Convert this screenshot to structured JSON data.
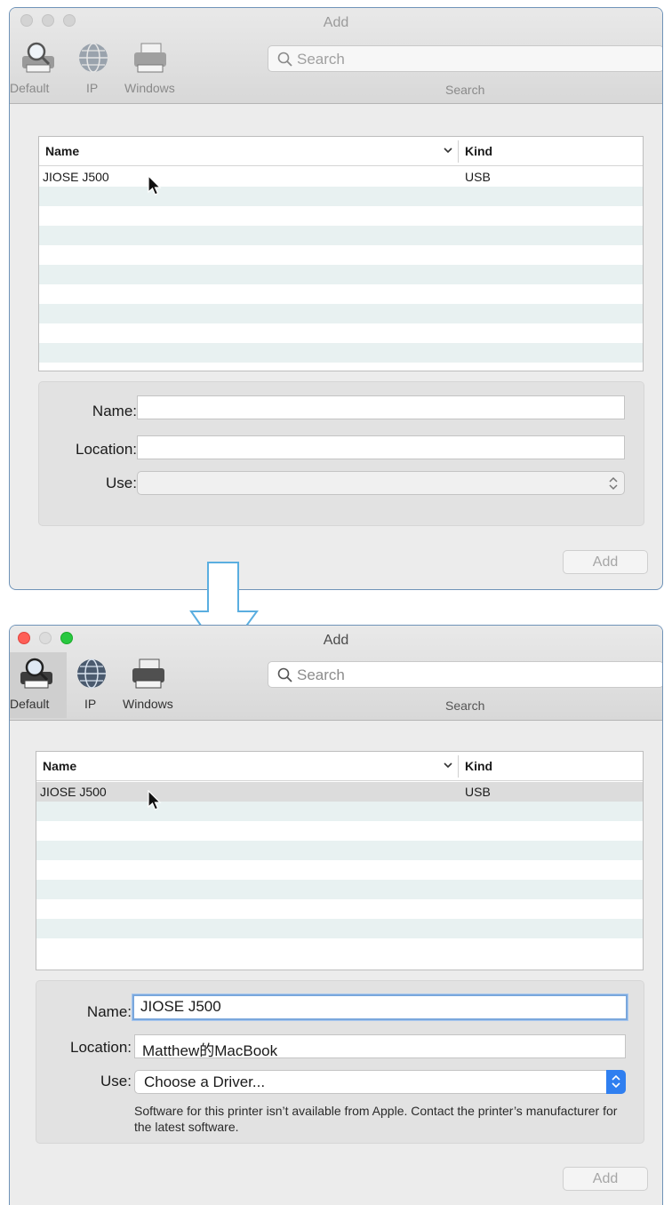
{
  "window": {
    "title": "Add"
  },
  "toolbar": {
    "buttons": [
      {
        "label": "Default",
        "icon": "default-printer-search-icon"
      },
      {
        "label": "IP",
        "icon": "ip-globe-icon"
      },
      {
        "label": "Windows",
        "icon": "windows-printer-icon"
      }
    ],
    "search_placeholder": "Search",
    "search_label": "Search"
  },
  "printer_list": {
    "columns": [
      "Name",
      "Kind"
    ],
    "rows": [
      {
        "name": "JIOSE J500",
        "kind": "USB"
      }
    ]
  },
  "form_labels": {
    "name": "Name:",
    "location": "Location:",
    "use": "Use:"
  },
  "after": {
    "name_value": "JIOSE J500",
    "location_value": "Matthew的MacBook",
    "use_value": "Choose a Driver...",
    "help_text": "Software for this printer isn’t available from Apple. Contact the printer’s manufacturer for the latest software."
  },
  "add_button_label": "Add",
  "colors": {
    "window_border": "#6f93b8",
    "row_stripe": "#e8f1f1",
    "selected_row": "#dcdcdc",
    "focus_ring": "#7aa7dc",
    "select_accent": "#2f7ff0",
    "arrow": "#5aaee0",
    "close": "#fe5f57",
    "zoom": "#28c840"
  }
}
